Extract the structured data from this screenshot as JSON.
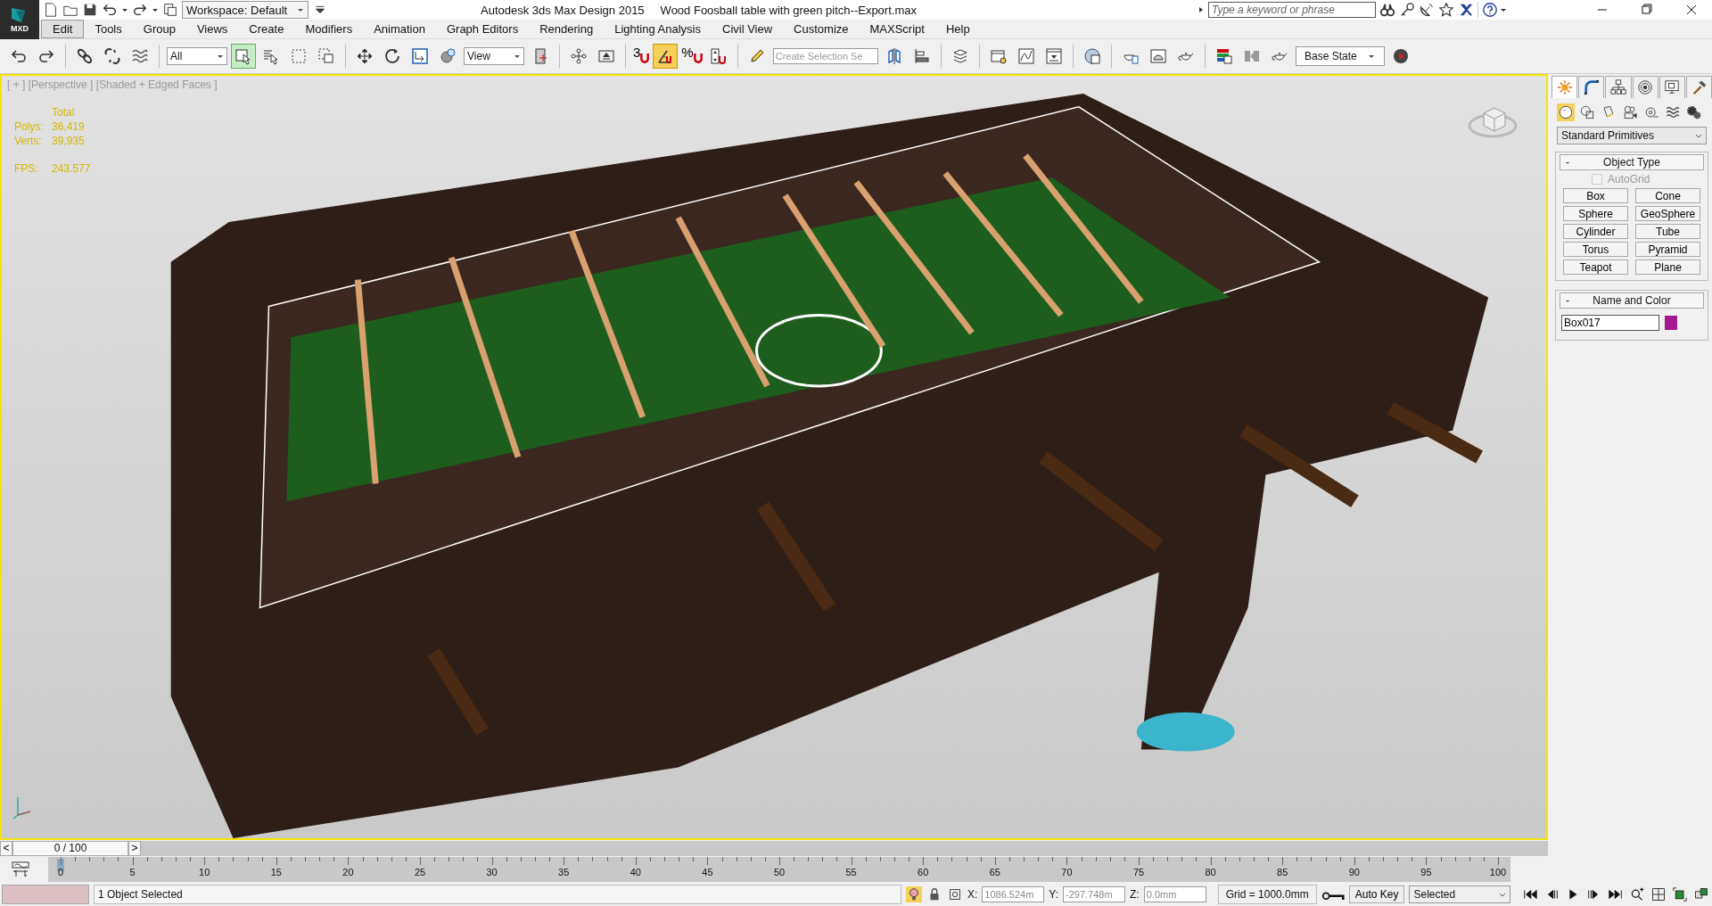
{
  "app_button": {
    "label": "MXD"
  },
  "quick_access": {
    "workspace": "Workspace: Default"
  },
  "window": {
    "app_name": "Autodesk 3ds Max Design 2015",
    "file_name": "Wood Foosball table with green pitch--Export.max"
  },
  "search": {
    "placeholder": "Type a keyword or phrase"
  },
  "menu": [
    {
      "label": "Edit",
      "selected": true
    },
    {
      "label": "Tools",
      "selected": false
    },
    {
      "label": "Group",
      "selected": false
    },
    {
      "label": "Views",
      "selected": false
    },
    {
      "label": "Create",
      "selected": false
    },
    {
      "label": "Modifiers",
      "selected": false
    },
    {
      "label": "Animation",
      "selected": false
    },
    {
      "label": "Graph Editors",
      "selected": false
    },
    {
      "label": "Rendering",
      "selected": false
    },
    {
      "label": "Lighting Analysis",
      "selected": false
    },
    {
      "label": "Civil View",
      "selected": false
    },
    {
      "label": "Customize",
      "selected": false
    },
    {
      "label": "MAXScript",
      "selected": false
    },
    {
      "label": "Help",
      "selected": false
    }
  ],
  "toolbar": [
    {
      "kind": "undo"
    },
    {
      "kind": "redo"
    },
    {
      "kind": "sep"
    },
    {
      "kind": "link"
    },
    {
      "kind": "unlink"
    },
    {
      "kind": "bind"
    },
    {
      "kind": "sep"
    },
    {
      "kind": "dropdown",
      "value": "All"
    },
    {
      "kind": "select",
      "selected": true
    },
    {
      "kind": "select-name",
      "selected": false
    },
    {
      "kind": "rect-region",
      "selected": false
    },
    {
      "kind": "window",
      "selected": false
    },
    {
      "kind": "sep"
    },
    {
      "kind": "move",
      "selected": false
    },
    {
      "kind": "rotate",
      "selected": false
    },
    {
      "kind": "scale",
      "selected": false
    },
    {
      "kind": "sphere",
      "selected": false
    },
    {
      "kind": "dropdown",
      "value": "View"
    },
    {
      "kind": "pivot",
      "selected": false
    },
    {
      "kind": "sep"
    },
    {
      "kind": "nodes",
      "selected": false
    },
    {
      "kind": "keyboard",
      "selected": false
    },
    {
      "kind": "sep"
    },
    {
      "kind": "snap",
      "text": "3",
      "selected": false
    },
    {
      "kind": "angle",
      "selected": true
    },
    {
      "kind": "snap",
      "text": "%",
      "selected": false
    },
    {
      "kind": "spinner",
      "selected": false
    },
    {
      "kind": "sep"
    },
    {
      "kind": "pencil",
      "selected": false
    },
    {
      "kind": "field",
      "placeholder": "Create Selection Se"
    },
    {
      "kind": "mirror",
      "selected": false
    },
    {
      "kind": "align",
      "selected": false
    },
    {
      "kind": "sep"
    },
    {
      "kind": "layers",
      "selected": false
    },
    {
      "kind": "sep"
    },
    {
      "kind": "explorer",
      "selected": false
    },
    {
      "kind": "graph",
      "selected": false
    },
    {
      "kind": "schematic",
      "selected": false
    },
    {
      "kind": "sep"
    },
    {
      "kind": "material",
      "selected": false
    },
    {
      "kind": "sep"
    },
    {
      "kind": "render-setup",
      "selected": false
    },
    {
      "kind": "frame",
      "selected": false
    },
    {
      "kind": "teapot",
      "selected": false
    },
    {
      "kind": "sep"
    },
    {
      "kind": "states",
      "selected": false
    },
    {
      "kind": "compare",
      "selected": false
    },
    {
      "kind": "teapot",
      "selected": false
    },
    {
      "kind": "dropdown",
      "value": "Base State"
    },
    {
      "kind": "play",
      "selected": false
    }
  ],
  "viewport": {
    "label": "[ + ] [Perspective ] [Shaded + Edged Faces ]",
    "stats_header": "Total",
    "stats": [
      {
        "label": "Polys:",
        "value": "36,419"
      },
      {
        "label": "Verts:",
        "value": "39,935"
      }
    ],
    "fps_label": "FPS:",
    "fps": "243.577"
  },
  "command_panel": {
    "tabs": [
      {
        "kind": "create",
        "selected": true
      },
      {
        "kind": "modify",
        "selected": false
      },
      {
        "kind": "hierarchy",
        "selected": false
      },
      {
        "kind": "motion",
        "selected": false
      },
      {
        "kind": "display",
        "selected": false
      },
      {
        "kind": "utilities",
        "selected": false
      }
    ],
    "categories": [
      {
        "kind": "geometry",
        "selected": true
      },
      {
        "kind": "shapes",
        "selected": false
      },
      {
        "kind": "lights",
        "selected": false
      },
      {
        "kind": "cameras",
        "selected": false
      },
      {
        "kind": "helpers",
        "selected": false
      },
      {
        "kind": "spacewarps",
        "selected": false
      },
      {
        "kind": "systems",
        "selected": false
      }
    ],
    "dropdown": "Standard Primitives",
    "object_type": {
      "toggle": "-",
      "title": "Object Type",
      "autogrid": {
        "label": "AutoGrid",
        "checked": false,
        "disabled": true
      },
      "buttons": [
        "Box",
        "Cone",
        "Sphere",
        "GeoSphere",
        "Cylinder",
        "Tube",
        "Torus",
        "Pyramid",
        "Teapot",
        "Plane"
      ]
    },
    "name_and_color": {
      "toggle": "-",
      "title": "Name and Color",
      "name": "Box017",
      "color": "#a4198f"
    }
  },
  "timeline": {
    "level": 0,
    "prev": "<",
    "slider": "0 / 100",
    "next": ">",
    "ticks": [
      "0",
      "5",
      "10",
      "15",
      "20",
      "25",
      "30",
      "35",
      "40",
      "45",
      "50",
      "55",
      "60",
      "65",
      "70",
      "75",
      "80",
      "85",
      "90",
      "95",
      "100"
    ]
  },
  "status": {
    "message": "1 Object Selected",
    "x_label": "X:",
    "x": "1086.524m",
    "y_label": "Y:",
    "y": "-297.748m",
    "z_label": "Z:",
    "z": "0.0mm",
    "grid": "Grid = 1000.0mm",
    "auto_key": "Auto Key",
    "key_filter": "Selected"
  }
}
